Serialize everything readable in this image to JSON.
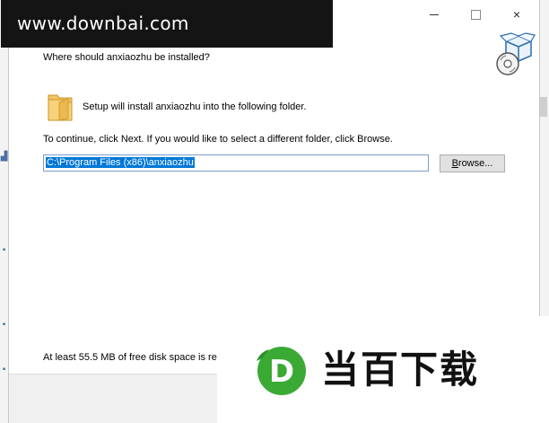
{
  "watermark": {
    "text": "www.downbai.com"
  },
  "window_controls": {
    "minimize": "minimize",
    "maximize": "maximize",
    "close": "×"
  },
  "header": {
    "title": "Where should anxiaozhu be installed?"
  },
  "body": {
    "intro": "Setup will install anxiaozhu into the following folder.",
    "instruction": "To continue, click Next. If you would like to select a different folder, click Browse.",
    "path_value": "C:\\Program Files (x86)\\anxiaozhu",
    "browse_label_underlined": "B",
    "browse_label_rest": "rowse...",
    "space_text": "At least 55.5 MB of free disk space is rec"
  },
  "logo": {
    "text": "当百下载",
    "letter": "D"
  },
  "icons": {
    "app": "installer-box-icon",
    "folder": "folder-icon"
  },
  "colors": {
    "accent": "#0078d7",
    "logo_green": "#3aaa35",
    "folder": "#f2c462"
  }
}
